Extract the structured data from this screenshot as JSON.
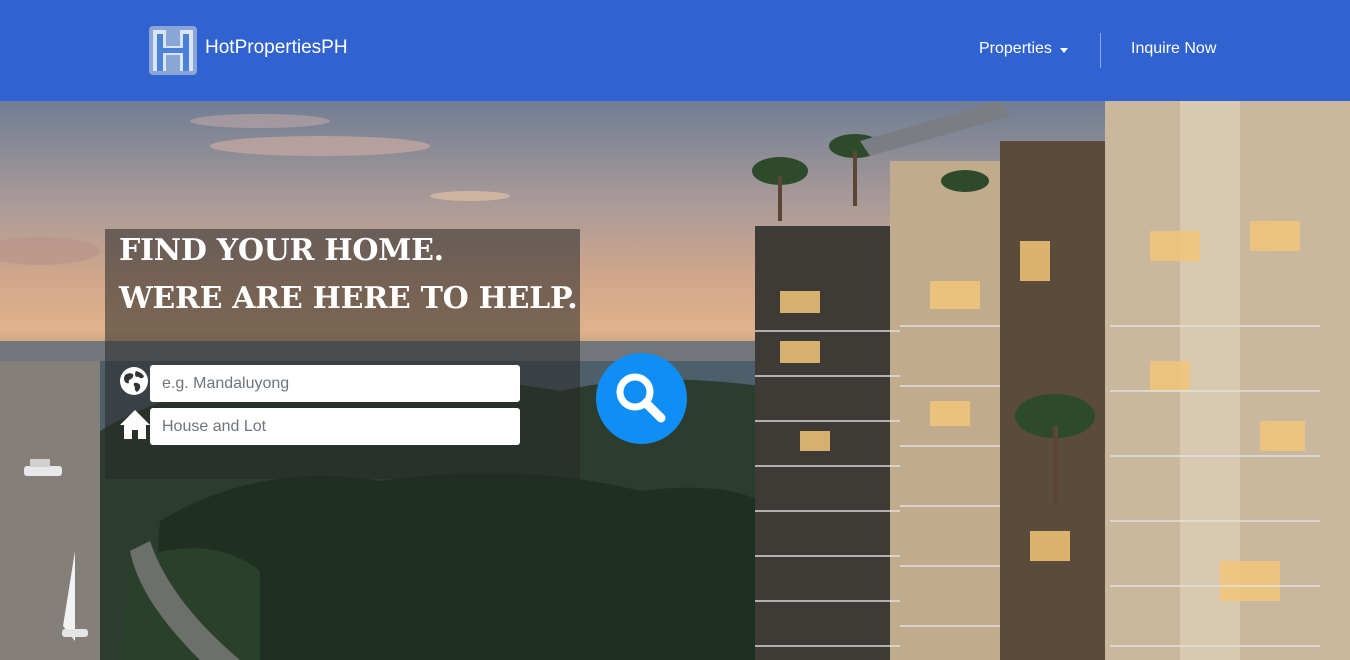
{
  "brand": {
    "name": "HotPropertiesPH"
  },
  "nav": {
    "properties_label": "Properties",
    "inquire_label": "Inquire Now"
  },
  "hero": {
    "headline_line1": "FIND YOUR HOME.",
    "headline_line2": "WERE ARE HERE TO HELP.",
    "location_placeholder": "e.g. Mandaluyong",
    "type_placeholder": "House and Lot"
  },
  "colors": {
    "navbar": "#3163d0",
    "search_button": "#0f8ff5"
  },
  "icons": [
    "brand-logo-icon",
    "caret-down-icon",
    "globe-icon",
    "home-icon",
    "search-icon"
  ]
}
